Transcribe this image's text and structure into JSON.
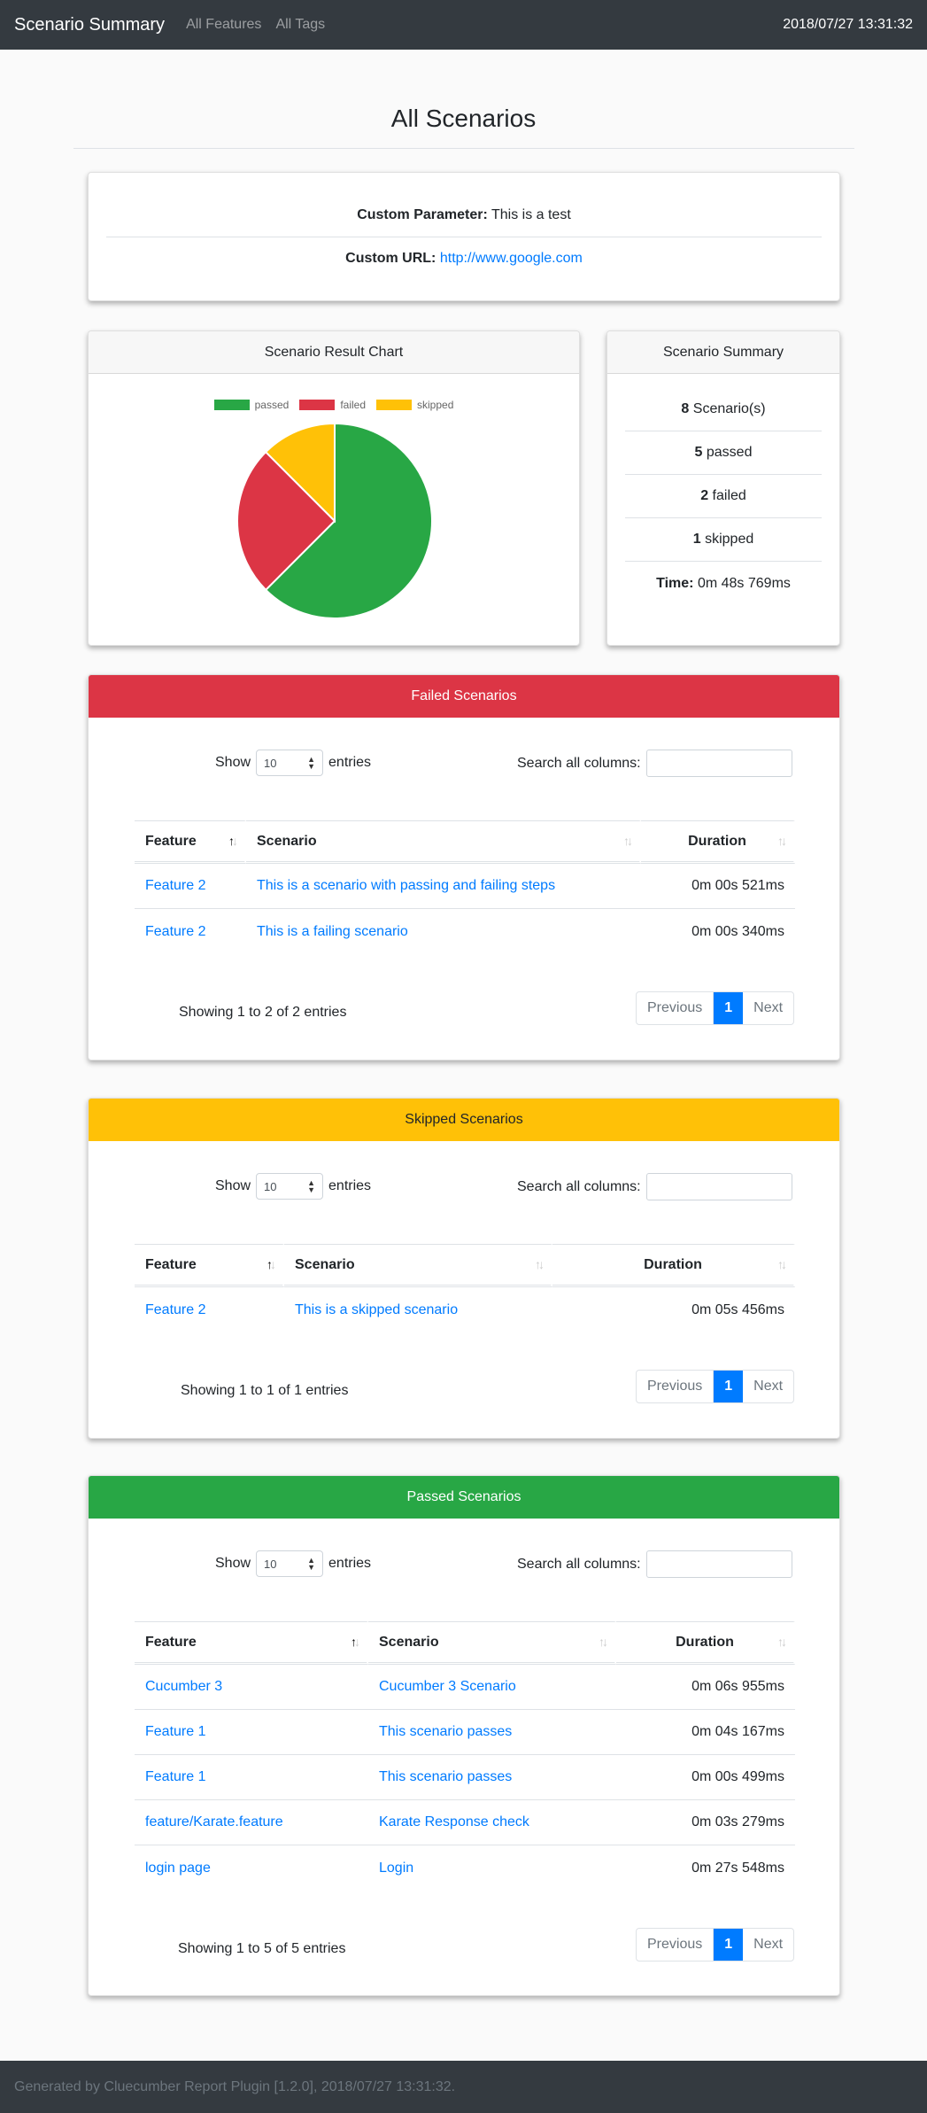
{
  "navbar": {
    "brand": "Scenario Summary",
    "links": [
      "All Features",
      "All Tags"
    ],
    "timestamp": "2018/07/27 13:31:32"
  },
  "page_title": "All Scenarios",
  "custom": {
    "param_label": "Custom Parameter:",
    "param_value": "This is a test",
    "url_label": "Custom URL:",
    "url_value": "http://www.google.com"
  },
  "chart_card": {
    "header": "Scenario Result Chart"
  },
  "chart_data": {
    "type": "pie",
    "labels": [
      "passed",
      "failed",
      "skipped"
    ],
    "values": [
      5,
      2,
      1
    ],
    "colors": [
      "#28a745",
      "#dc3545",
      "#ffc107"
    ],
    "legend": "top"
  },
  "summary": {
    "header": "Scenario Summary",
    "total_count": "8",
    "total_label": "Scenario(s)",
    "passed_count": "5",
    "passed_label": "passed",
    "failed_count": "2",
    "failed_label": "failed",
    "skipped_count": "1",
    "skipped_label": "skipped",
    "time_label": "Time:",
    "time_value": "0m 48s 769ms"
  },
  "colors": {
    "failed": "#dc3545",
    "skipped": "#ffc107",
    "passed": "#28a745",
    "link": "#007bff",
    "navbar": "#343a40"
  },
  "controls": {
    "show": "Show",
    "entries": "entries",
    "page_size": "10",
    "search_label": "Search all columns:",
    "prev": "Previous",
    "next": "Next",
    "page": "1",
    "col_feature": "Feature",
    "col_scenario": "Scenario",
    "col_duration": "Duration"
  },
  "failed": {
    "header": "Failed Scenarios",
    "rows": [
      {
        "feature": "Feature 2",
        "scenario": "This is a scenario with passing and failing steps",
        "duration": "0m 00s 521ms"
      },
      {
        "feature": "Feature 2",
        "scenario": "This is a failing scenario",
        "duration": "0m 00s 340ms"
      }
    ],
    "info": "Showing 1 to 2 of 2 entries"
  },
  "skipped": {
    "header": "Skipped Scenarios",
    "rows": [
      {
        "feature": "Feature 2",
        "scenario": "This is a skipped scenario",
        "duration": "0m 05s 456ms"
      }
    ],
    "info": "Showing 1 to 1 of 1 entries"
  },
  "passed": {
    "header": "Passed Scenarios",
    "rows": [
      {
        "feature": "Cucumber 3",
        "scenario": "Cucumber 3 Scenario",
        "duration": "0m 06s 955ms"
      },
      {
        "feature": "Feature 1",
        "scenario": "This scenario passes",
        "duration": "0m 04s 167ms"
      },
      {
        "feature": "Feature 1",
        "scenario": "This scenario passes",
        "duration": "0m 00s 499ms"
      },
      {
        "feature": "feature/Karate.feature",
        "scenario": "Karate Response check",
        "duration": "0m 03s 279ms"
      },
      {
        "feature": "login page",
        "scenario": "Login",
        "duration": "0m 27s 548ms"
      }
    ],
    "info": "Showing 1 to 5 of 5 entries"
  },
  "footer": "Generated by Cluecumber Report Plugin [1.2.0], 2018/07/27 13:31:32."
}
